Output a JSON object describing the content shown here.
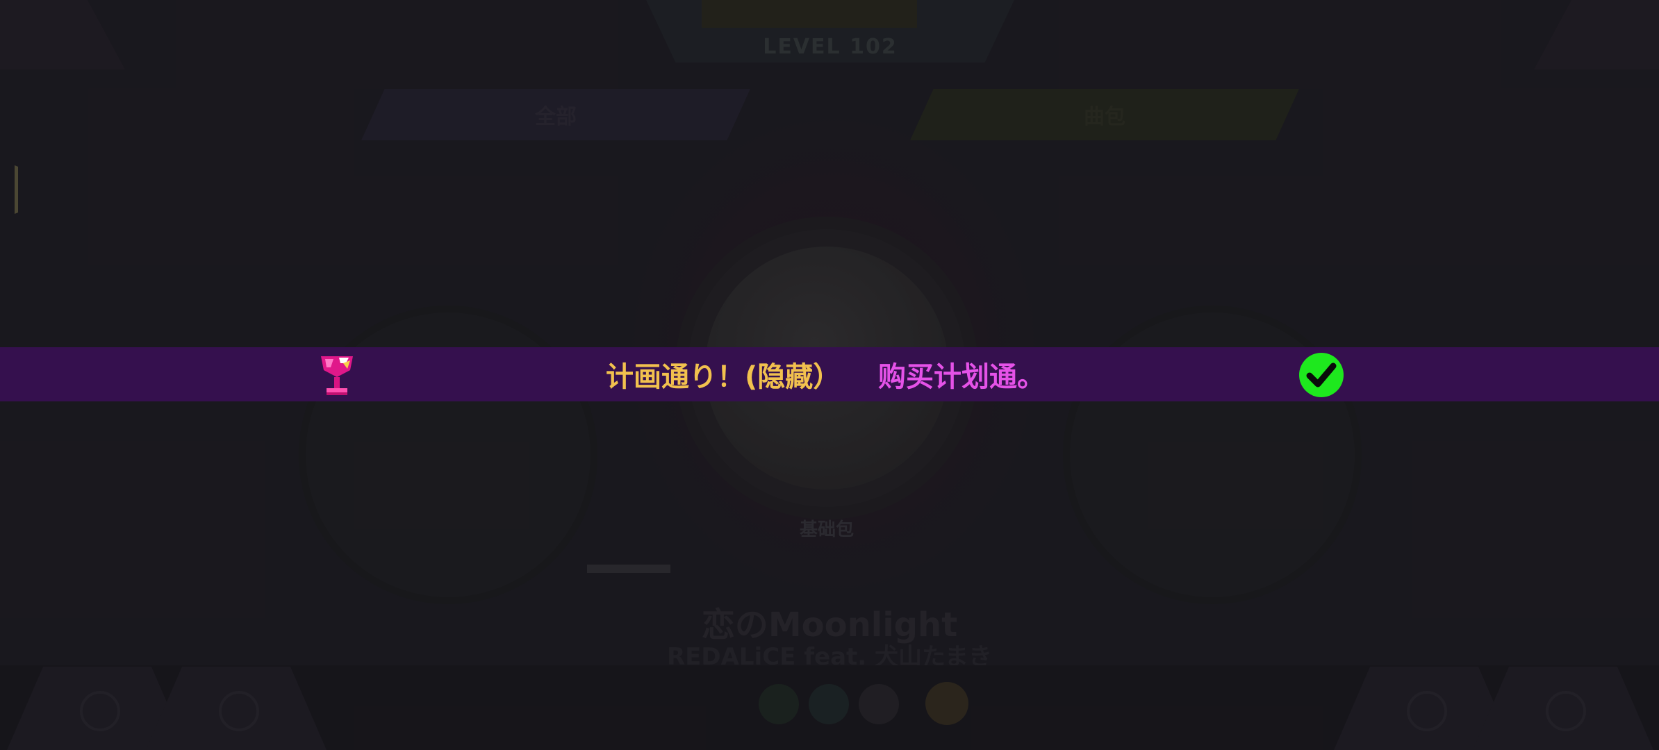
{
  "background": {
    "level_label": "LEVEL 102",
    "tab_left": "全部",
    "tab_right": "曲包",
    "pack_name": "基础包",
    "song_title": "恋のMoonlight",
    "song_artist": "REDALiCE feat. 犬山たまき"
  },
  "achievement": {
    "title": "计画通り！(隐藏）",
    "description": "购买计划通。",
    "trophy_icon": "trophy-icon",
    "status_icon": "checkmark-icon",
    "colors": {
      "banner": "#35104e",
      "title": "#f2c14e",
      "description": "#e552e8",
      "check": "#1ee81e"
    }
  }
}
